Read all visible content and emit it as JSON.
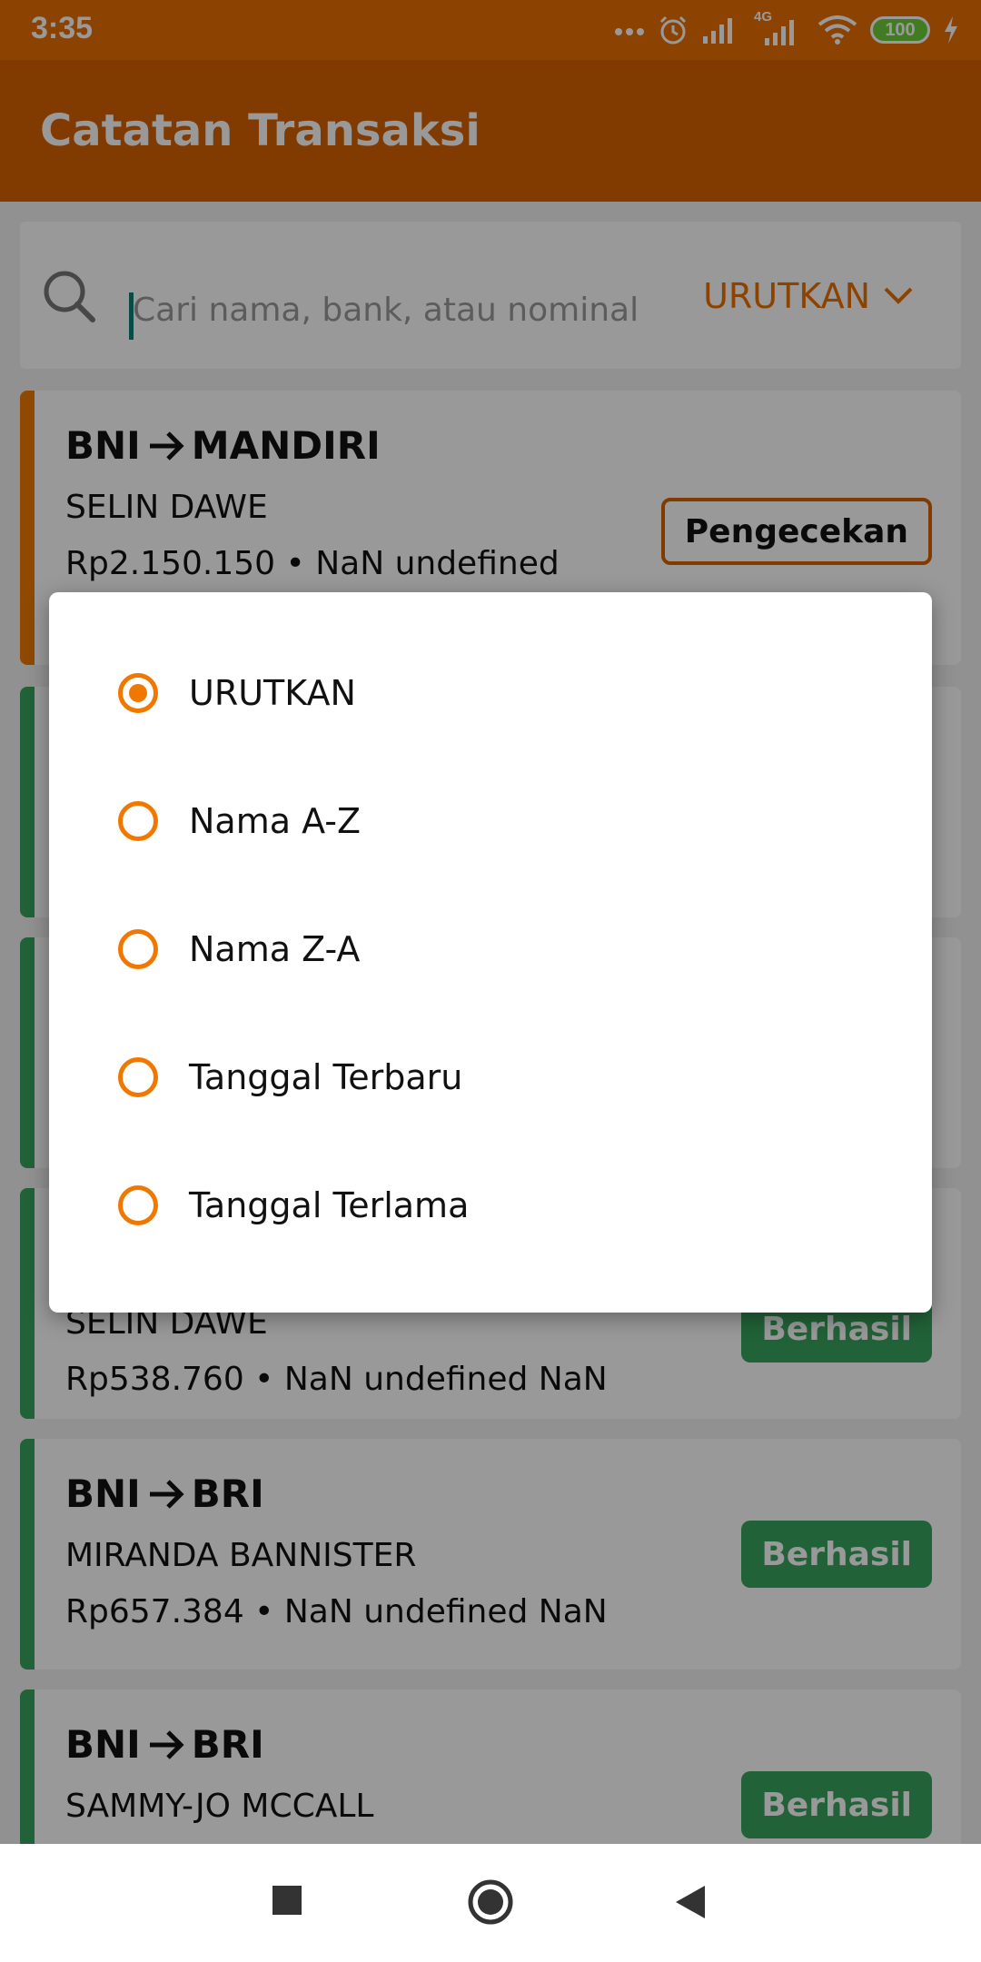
{
  "status_bar": {
    "time": "3:35",
    "network_label": "4G",
    "battery": "100",
    "icons": [
      "more-dots-icon",
      "alarm-icon",
      "signal-icon",
      "signal-4g-icon",
      "wifi-icon",
      "battery-icon",
      "charging-icon"
    ]
  },
  "app_bar": {
    "title": "Catatan Transaksi"
  },
  "search": {
    "placeholder": "Cari nama, bank, atau nominal",
    "sort_label": "URUTKAN"
  },
  "transactions": [
    {
      "from": "BNI",
      "to": "MANDIRI",
      "name": "SELIN DAWE",
      "amount": "Rp2.150.150 • NaN undefined",
      "status": "Pengecekan",
      "status_type": "pending"
    },
    {
      "from": "",
      "to": "",
      "name": "",
      "amount": "",
      "status": "",
      "status_type": "success"
    },
    {
      "from": "",
      "to": "",
      "name": "",
      "amount": "",
      "status": "",
      "status_type": "success"
    },
    {
      "from": "",
      "to": "",
      "name": "SELIN DAWE",
      "amount": "Rp538.760 • NaN undefined NaN",
      "status": "Berhasil",
      "status_type": "success"
    },
    {
      "from": "BNI",
      "to": "BRI",
      "name": "MIRANDA BANNISTER",
      "amount": "Rp657.384 • NaN undefined NaN",
      "status": "Berhasil",
      "status_type": "success"
    },
    {
      "from": "BNI",
      "to": "BRI",
      "name": "SAMMY-JO MCCALL",
      "amount": "",
      "status": "Berhasil",
      "status_type": "success"
    }
  ],
  "sort_dialog": {
    "selected_index": 0,
    "options": [
      "URUTKAN",
      "Nama A-Z",
      "Nama Z-A",
      "Tanggal Terbaru",
      "Tanggal Terlama"
    ]
  },
  "colors": {
    "primary": "#d86300",
    "accent": "#f07800",
    "success": "#37a35e",
    "status_bar": "#e96f00"
  },
  "nav_bar": {
    "icons": [
      "recents-square-icon",
      "home-circle-icon",
      "back-triangle-icon"
    ]
  }
}
